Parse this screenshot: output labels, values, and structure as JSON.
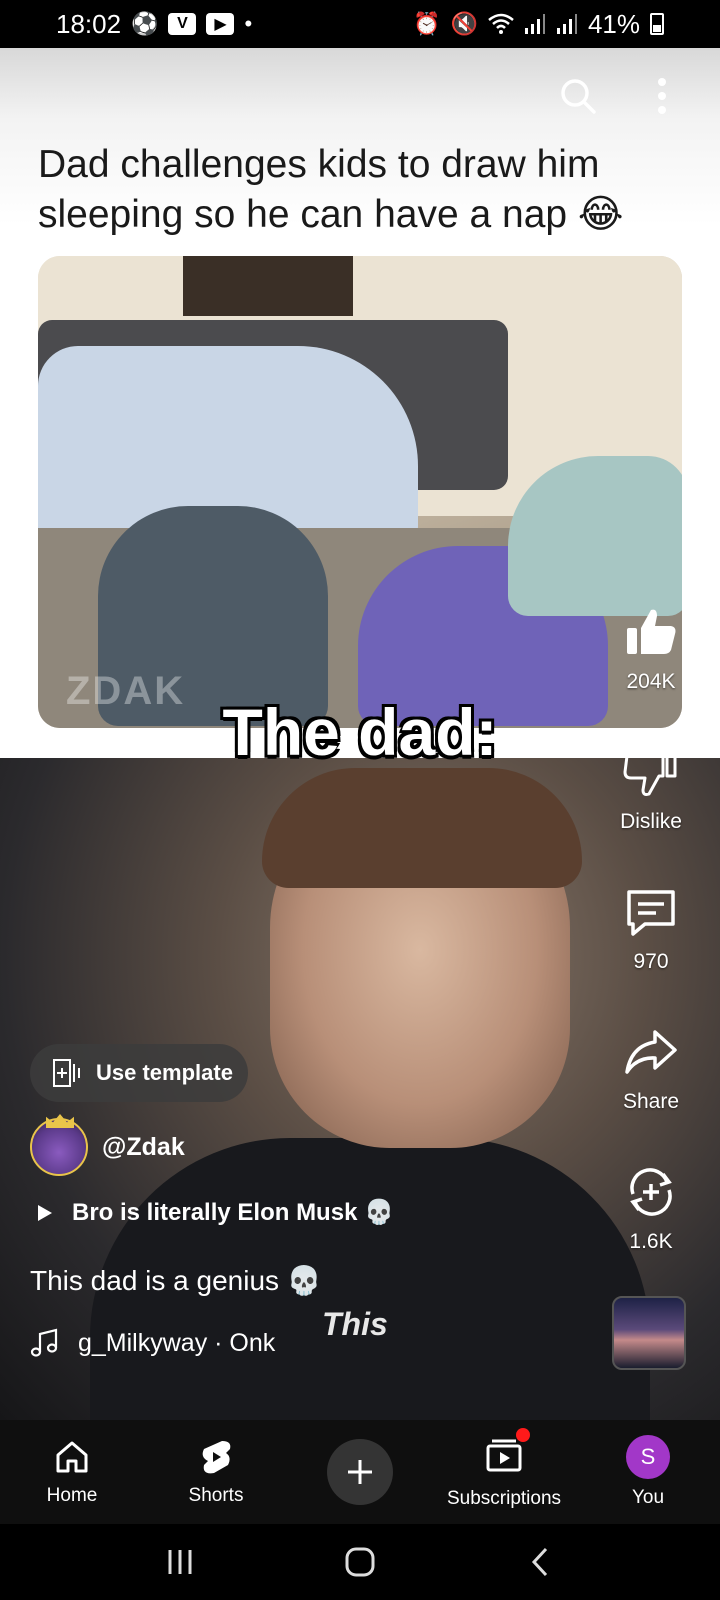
{
  "status_bar": {
    "time": "18:02",
    "left_icons": [
      "soccer-ball-icon",
      "v-app-icon",
      "youtube-icon",
      "dot-icon"
    ],
    "right_icons": [
      "alarm-icon",
      "mute-icon",
      "wifi-icon",
      "signal-icon",
      "signal-icon"
    ],
    "battery": "41%"
  },
  "video": {
    "title": "Dad challenges kids to draw him sleeping so he can have a nap 😂",
    "watermark": "ZDAK",
    "overlay_text": "The dad:",
    "subtitle_text": "This"
  },
  "actions": {
    "likes": "204K",
    "dislike_label": "Dislike",
    "comments": "970",
    "share_label": "Share",
    "remix_count": "1.6K"
  },
  "info": {
    "template_label": "Use template",
    "channel": "@Zdak",
    "related_title": "Bro is literally Elon Musk 💀",
    "caption": "This dad is a genius 💀",
    "sound": "g_Milkyway · Onk"
  },
  "bottom_nav": {
    "items": [
      {
        "label": "Home",
        "icon": "home-icon"
      },
      {
        "label": "Shorts",
        "icon": "shorts-icon"
      },
      {
        "label": "",
        "icon": "plus-icon"
      },
      {
        "label": "Subscriptions",
        "icon": "subscriptions-icon"
      },
      {
        "label": "You",
        "icon": "avatar"
      }
    ],
    "you_initial": "S"
  },
  "colors": {
    "accent_you": "#a237c8",
    "notification": "#ff1a1a",
    "nav_bg": "#0f0f0f"
  }
}
